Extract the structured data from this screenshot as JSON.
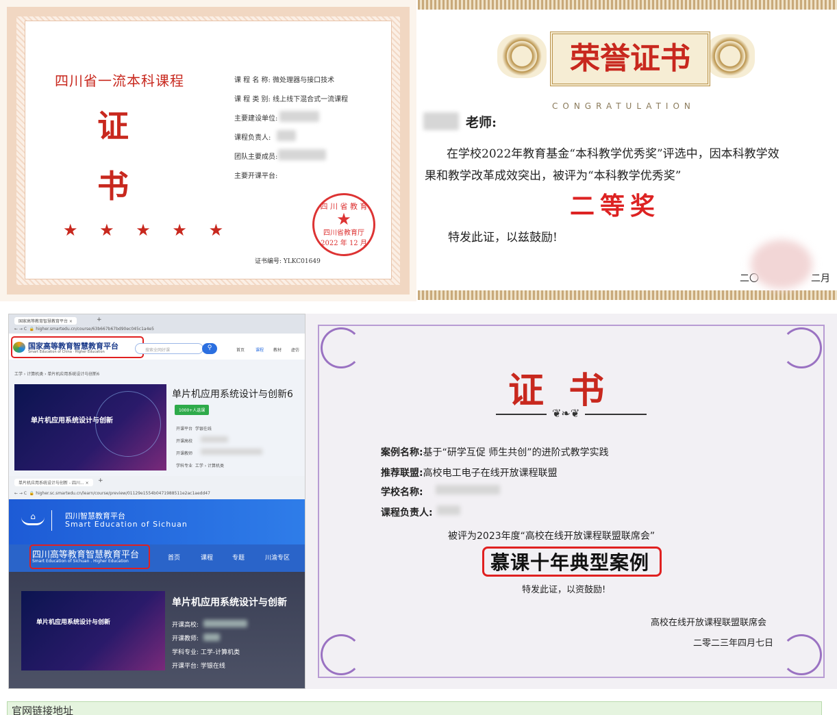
{
  "cert1": {
    "title": "四川省一流本科课程",
    "char1": "证",
    "char2": "书",
    "stars": "★ ★ ★ ★ ★",
    "fields": [
      {
        "label": "课 程 名 称:",
        "value": "微处理器与接口技术"
      },
      {
        "label": "课 程 类 别:",
        "value": "线上线下混合式一流课程"
      },
      {
        "label": "主要建设单位:",
        "value": ""
      },
      {
        "label": "课程负责人:",
        "value": ""
      },
      {
        "label": "团队主要成员:",
        "value": ""
      },
      {
        "label": "主要开课平台:",
        "value": ""
      }
    ],
    "seal_top": "四 川 省 教 育",
    "seal_org": "四川省教育厅",
    "seal_date": "2022 年 12 月",
    "number": "证书编号: YLKC01649"
  },
  "cert2": {
    "title": "荣誉证书",
    "congrats": "CONGRATULATION",
    "addressee": "老师:",
    "body1": "在学校2022年教育基金“本科教学优秀奖”评选中，因本科教学效",
    "body2": "果和教学改革成效突出，被评为“本科教学优秀奖”",
    "award": "二等奖",
    "closing": "特发此证，以兹鼓励!",
    "date_left": "二〇",
    "date_right": "二月"
  },
  "screens": {
    "tab1": "国家高等教育智慧教育平台",
    "url1": "higher.smartedu.cn/course/63b667b67bd90ec045c1a4e5",
    "logo1_cn": "国家高等教育智慧教育平台",
    "logo1_en": "Smart Education of China · Higher Education",
    "search_placeholder": "搜索全网好课",
    "nav1": [
      "首页",
      "课程",
      "教材",
      "虚仿"
    ],
    "crumbs": "工学 › 计算机类 › 单片机应用系统设计与创新6",
    "course1_title": "单片机应用系统设计与创新6",
    "course1_badge": "1000+人选课",
    "course1_rows": [
      {
        "label": "开课平台",
        "value": "学银在线"
      },
      {
        "label": "开课高校",
        "value": ""
      },
      {
        "label": "开课教师",
        "value": ""
      },
      {
        "label": "学科专业",
        "value": "工学 › 计算机类"
      }
    ],
    "thumb_title": "单片机应用系统设计与创新",
    "tab2": "单片机应用系统设计与创新 - 四川...",
    "url2": "higher.sc.smartedu.cn/learn/course/preview/01129e1554b0471988511e2ac1aedd47",
    "logo2_cn": "四川智慧教育平台",
    "logo2_en": "Smart Education of Sichuan",
    "logo3_cn": "四川高等教育智慧教育平台",
    "logo3_en": "Smart Education of Sichuan . Higher Education",
    "nav2": [
      "首页",
      "课程",
      "专题",
      "川渝专区"
    ],
    "course2_title": "单片机应用系统设计与创新",
    "course2_rows": [
      {
        "label": "开课高校:",
        "value": ""
      },
      {
        "label": "开课教师:",
        "value": ""
      },
      {
        "label": "学科专业:",
        "value": "工学-计算机类"
      },
      {
        "label": "开课平台:",
        "value": "学银在线"
      }
    ]
  },
  "cert3": {
    "title": "证  书",
    "rows": [
      {
        "label": "案例名称:",
        "value": "基于“研学互促 师生共创”的进阶式教学实践"
      },
      {
        "label": "推荐联盟:",
        "value": "高校电工电子在线开放课程联盟"
      },
      {
        "label": "学校名称:",
        "value": ""
      },
      {
        "label": "课程负责人:",
        "value": ""
      }
    ],
    "line1": "被评为2023年度“高校在线开放课程联盟联席会”",
    "highlight": "慕课十年典型案例",
    "closing": "特发此证，以资鼓励!",
    "issuer": "高校在线开放课程联盟联席会",
    "date": "二零二三年四月七日"
  },
  "footer": {
    "label": "官网链接地址"
  },
  "colors": {
    "red": "#c8281e",
    "gold": "#b9924a",
    "purple": "#9a72c2",
    "highlight_box": "#e02020"
  }
}
